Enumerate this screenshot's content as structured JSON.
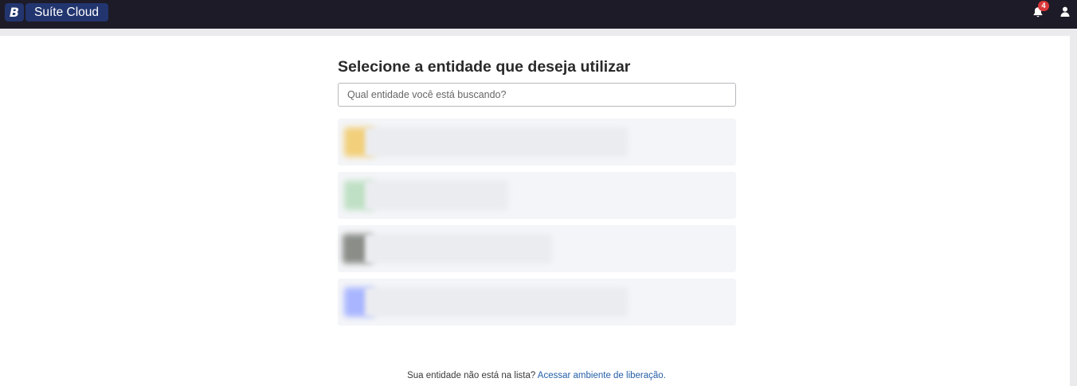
{
  "header": {
    "brand_logo": "B",
    "app_name": "Suíte Cloud",
    "notification_count": "4",
    "icons": [
      "bell-icon",
      "user-icon"
    ]
  },
  "main": {
    "title": "Selecione a entidade que deseja utilizar",
    "search_placeholder": "Qual entidade você está buscando?",
    "search_value": "",
    "entities": [
      {
        "icon_color": "#f2cf7a"
      },
      {
        "icon_color": "#bfe0c4"
      },
      {
        "icon_color": "#8a8d88"
      },
      {
        "icon_color": "#a9b6ff"
      }
    ]
  },
  "footer": {
    "text": "Sua entidade não está na lista?",
    "link_label": "Acessar ambiente de liberação."
  },
  "colors": {
    "topbar": "#1d1b27",
    "brand": "#22356f",
    "badge": "#d9383a",
    "link": "#245fa8"
  }
}
